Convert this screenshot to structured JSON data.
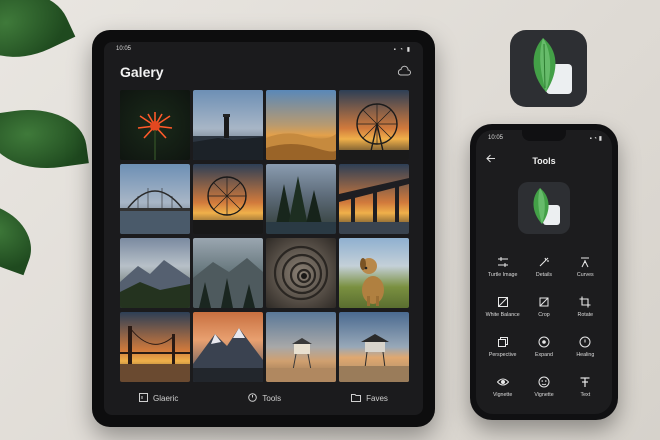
{
  "tablet": {
    "status_time": "10:05",
    "status_icons": "▪ ◔ ▮",
    "title": "Galery",
    "cloud_icon": "cloud-icon",
    "nav": [
      {
        "label": "Glaeric",
        "icon": "image-icon"
      },
      {
        "label": "Tools",
        "icon": "tools-icon"
      },
      {
        "label": "Faves",
        "icon": "folder-icon"
      }
    ]
  },
  "phone": {
    "status_time": "10:05",
    "status_icons": "▪ ◔ ▮",
    "back_icon": "back-arrow-icon",
    "title": "Tools",
    "tools": [
      {
        "label": "Turtle Image",
        "icon": "tune-icon"
      },
      {
        "label": "Details",
        "icon": "details-icon"
      },
      {
        "label": "Curves",
        "icon": "curves-icon"
      },
      {
        "label": "White Balance",
        "icon": "white-balance-icon"
      },
      {
        "label": "Crop",
        "icon": "crop-icon"
      },
      {
        "label": "Rotate",
        "icon": "rotate-icon"
      },
      {
        "label": "Perspective",
        "icon": "perspective-icon"
      },
      {
        "label": "Expand",
        "icon": "expand-icon"
      },
      {
        "label": "Healing",
        "icon": "healing-icon"
      },
      {
        "label": "Vignette",
        "icon": "eye-icon"
      },
      {
        "label": "Vignette",
        "icon": "face-icon"
      },
      {
        "label": "Text",
        "icon": "text-icon"
      }
    ]
  },
  "colors": {
    "leaf_green": "#2f6a2c",
    "logo_green": "#4caf50",
    "screen_bg": "#1b1b1d"
  }
}
